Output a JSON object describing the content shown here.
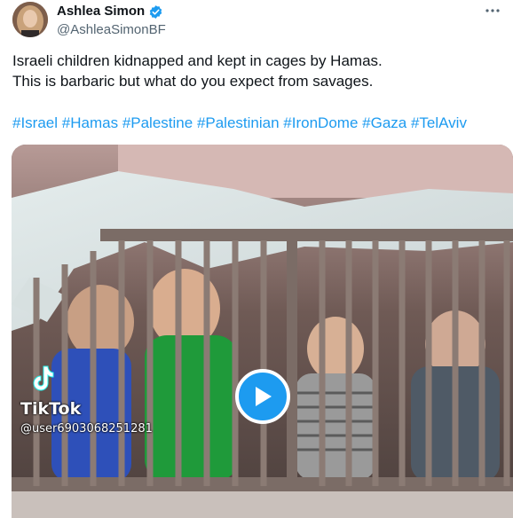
{
  "author": {
    "display_name": "Ashlea Simon",
    "handle": "@AshleaSimonBF",
    "verified": true,
    "verified_color": "#1d9bf0"
  },
  "more_icon": "more-horizontal-icon",
  "tweet": {
    "lines": [
      "Israeli children kidnapped and kept in cages by Hamas.",
      "This is barbaric but what do you expect from savages."
    ],
    "hashtags": [
      "#Israel",
      "#Hamas",
      "#Palestine",
      "#Palestinian",
      "#IronDome",
      "#Gaza",
      "#TelAviv"
    ],
    "link_color": "#1d9bf0"
  },
  "media": {
    "type": "video",
    "play_icon": "play-icon",
    "watermark": {
      "brand": "TikTok",
      "user": "@user6903068251281"
    }
  }
}
